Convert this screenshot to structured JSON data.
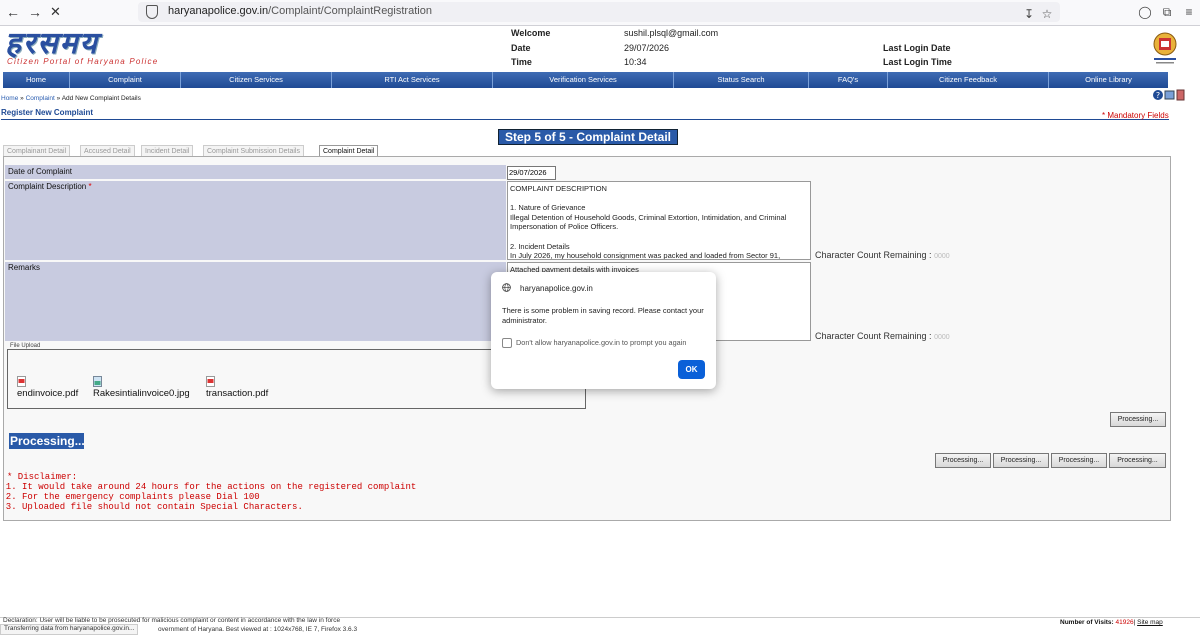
{
  "browser": {
    "url_host": "haryanapolice.gov.in",
    "url_path": "/Complaint/ComplaintRegistration"
  },
  "header": {
    "logo_text": "हरसमय",
    "logo_tagline": "Citizen Portal of Haryana Police",
    "welcome_label": "Welcome",
    "welcome_value": "sushil.plsql@gmail.com",
    "date_label": "Date",
    "date_value": "29/07/2026",
    "time_label": "Time",
    "time_value": "10:34",
    "last_login_date_label": "Last Login Date",
    "last_login_time_label": "Last Login Time"
  },
  "menu": [
    "Home",
    "Complaint",
    "Citizen Services",
    "RTI Act Services",
    "Verification Services",
    "Status Search",
    "FAQ's",
    "Citizen Feedback",
    "Online Library"
  ],
  "breadcrumb": {
    "home": "Home",
    "sep1": " » ",
    "complaint": "Complaint",
    "sep2": " » ",
    "current": "Add New Complaint Details"
  },
  "section_title": "Register New Complaint",
  "mandatory_note": "* Mandatory Fields",
  "step_title": "Step 5 of 5 - Complaint Detail",
  "tabs": [
    "Complainant Detail",
    "Accused Detail",
    "Incident Detail",
    "Complaint Submission Details",
    "Complaint Detail"
  ],
  "form": {
    "date_label": "Date of Complaint",
    "date_value": "29/07/2026",
    "desc_label": "Complaint Description",
    "required_mark": "*",
    "desc_value": "COMPLAINT DESCRIPTION\n\n1. Nature of Grievance\nIllegal Detention of Household Goods, Criminal Extortion, Intimidation, and Criminal Impersonation of Police Officers.\n\n2. Incident Details\nIn July 2026, my household consignment was packed and loaded from Sector 91,",
    "remarks_label": "Remarks",
    "remarks_value": "Attached payment details with invoices",
    "char_count_label": "Character Count Remaining :",
    "char_count_value": "0000",
    "remarks_char_count_value": "0000"
  },
  "file_upload": {
    "legend": "File Upload",
    "files": [
      "endinvoice.pdf",
      "Rakesintialinvoice0.jpg",
      "transaction.pdf"
    ]
  },
  "processing_label": "Processing...",
  "buttons": {
    "processing": "Processing..."
  },
  "disclaimer": {
    "title": "* Disclaimer:",
    "items": [
      "It would take around 24 hours for the actions on the registered complaint",
      "For the emergency complaints please Dial 100",
      "Uploaded file should not contain Special Characters."
    ]
  },
  "footer": {
    "notice_start": "Declaration: User will be liable to be prosecuted for malicious complaint or content in accordance with the law in force",
    "status": "Transferring data from haryanapolice.gov.in...",
    "govt": "overnment of Haryana. Best viewed at : 1024x768, IE 7, Firefox 3.6.3",
    "visits_label": "Number of Visits:",
    "visits_count": "41926",
    "sep": "|",
    "sitemap": "Site map"
  },
  "dialog": {
    "origin": "haryanapolice.gov.in",
    "message": "There is some problem in saving record. Please contact your administrator.",
    "checkbox_label": "Don't allow haryanapolice.gov.in to prompt you again",
    "ok": "OK"
  }
}
